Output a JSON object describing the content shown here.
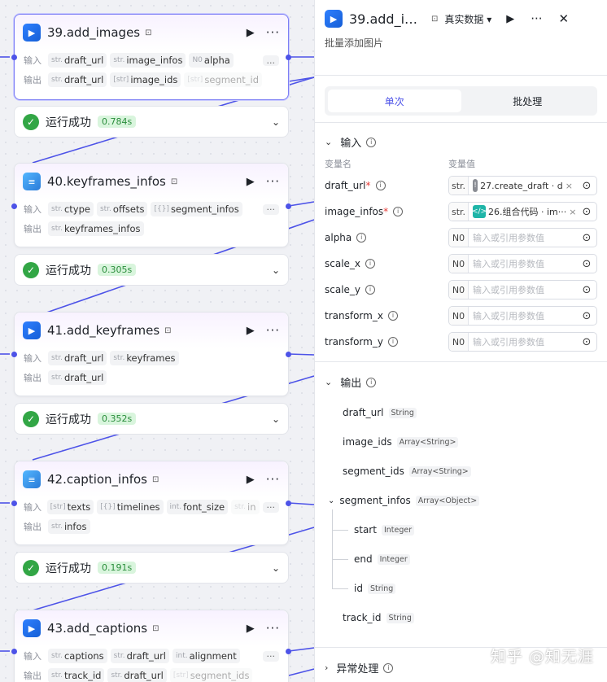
{
  "nodes": [
    {
      "title": "39.add_images",
      "icon": "play-box-icon",
      "input_label": "输入",
      "output_label": "输出",
      "inputs": [
        {
          "t": "str.",
          "n": "draft_url"
        },
        {
          "t": "str.",
          "n": "image_infos"
        },
        {
          "t": "N0",
          "n": "alpha"
        },
        {
          "t": "",
          "n": "..."
        }
      ],
      "outputs": [
        {
          "t": "str.",
          "n": "draft_url"
        },
        {
          "t": "[str]",
          "n": "image_ids"
        },
        {
          "t": "[str]",
          "n": "segment_id"
        }
      ],
      "status": "运行成功",
      "time": "0.784s"
    },
    {
      "title": "40.keyframes_infos",
      "icon": "code-doc-icon",
      "input_label": "输入",
      "output_label": "输出",
      "inputs": [
        {
          "t": "str.",
          "n": "ctype"
        },
        {
          "t": "str.",
          "n": "offsets"
        },
        {
          "t": "[{}]",
          "n": "segment_infos"
        }
      ],
      "outputs": [
        {
          "t": "str.",
          "n": "keyframes_infos"
        }
      ],
      "status": "运行成功",
      "time": "0.305s"
    },
    {
      "title": "41.add_keyframes",
      "icon": "play-box-icon",
      "input_label": "输入",
      "output_label": "输出",
      "inputs": [
        {
          "t": "str.",
          "n": "draft_url"
        },
        {
          "t": "str.",
          "n": "keyframes"
        }
      ],
      "outputs": [
        {
          "t": "str.",
          "n": "draft_url"
        }
      ],
      "status": "运行成功",
      "time": "0.352s"
    },
    {
      "title": "42.caption_infos",
      "icon": "code-doc-icon",
      "input_label": "输入",
      "output_label": "输出",
      "inputs": [
        {
          "t": "[str]",
          "n": "texts"
        },
        {
          "t": "[{}]",
          "n": "timelines"
        },
        {
          "t": "int.",
          "n": "font_size"
        },
        {
          "t": "str.",
          "n": "in"
        }
      ],
      "outputs": [
        {
          "t": "str.",
          "n": "infos"
        }
      ],
      "status": "运行成功",
      "time": "0.191s"
    },
    {
      "title": "43.add_captions",
      "icon": "play-box-icon",
      "input_label": "输入",
      "output_label": "输出",
      "inputs": [
        {
          "t": "str.",
          "n": "captions"
        },
        {
          "t": "str.",
          "n": "draft_url"
        },
        {
          "t": "int.",
          "n": "alignment"
        }
      ],
      "outputs": [
        {
          "t": "str.",
          "n": "track_id"
        },
        {
          "t": "str.",
          "n": "draft_url"
        },
        {
          "t": "[str]",
          "n": "segment_ids"
        }
      ]
    }
  ],
  "panel": {
    "title": "39.add_i…",
    "data_mode": "真实数据 ▾",
    "description": "批量添加图片",
    "tabs": [
      "单次",
      "批处理"
    ],
    "input_section": "输入",
    "col_name": "变量名",
    "col_value": "变量值",
    "params": [
      {
        "name": "draft_url",
        "req": "*",
        "type": "str.",
        "value": "27.create_draft · d",
        "ref": "grey"
      },
      {
        "name": "image_infos",
        "req": "*",
        "type": "str.",
        "value": "26.组合代码 · im···",
        "ref": "teal"
      },
      {
        "name": "alpha",
        "req": "",
        "type": "N0",
        "placeholder": "输入或引用参数值"
      },
      {
        "name": "scale_x",
        "req": "",
        "type": "N0",
        "placeholder": "输入或引用参数值"
      },
      {
        "name": "scale_y",
        "req": "",
        "type": "N0",
        "placeholder": "输入或引用参数值"
      },
      {
        "name": "transform_x",
        "req": "",
        "type": "N0",
        "placeholder": "输入或引用参数值"
      },
      {
        "name": "transform_y",
        "req": "",
        "type": "N0",
        "placeholder": "输入或引用参数值"
      }
    ],
    "output_section": "输出",
    "outputs": [
      {
        "name": "draft_url",
        "type": "String"
      },
      {
        "name": "image_ids",
        "type": "Array<String>"
      },
      {
        "name": "segment_ids",
        "type": "Array<String>"
      },
      {
        "name": "segment_infos",
        "type": "Array<Object>"
      },
      {
        "name": "start",
        "type": "Integer"
      },
      {
        "name": "end",
        "type": "Integer"
      },
      {
        "name": "id",
        "type": "String"
      },
      {
        "name": "track_id",
        "type": "String"
      }
    ],
    "exception_section": "异常处理"
  },
  "watermark": "知乎 @知无涯",
  "colors": {
    "accent": "#4d53e8",
    "success": "#32a645",
    "edge": "#4d53e8"
  }
}
